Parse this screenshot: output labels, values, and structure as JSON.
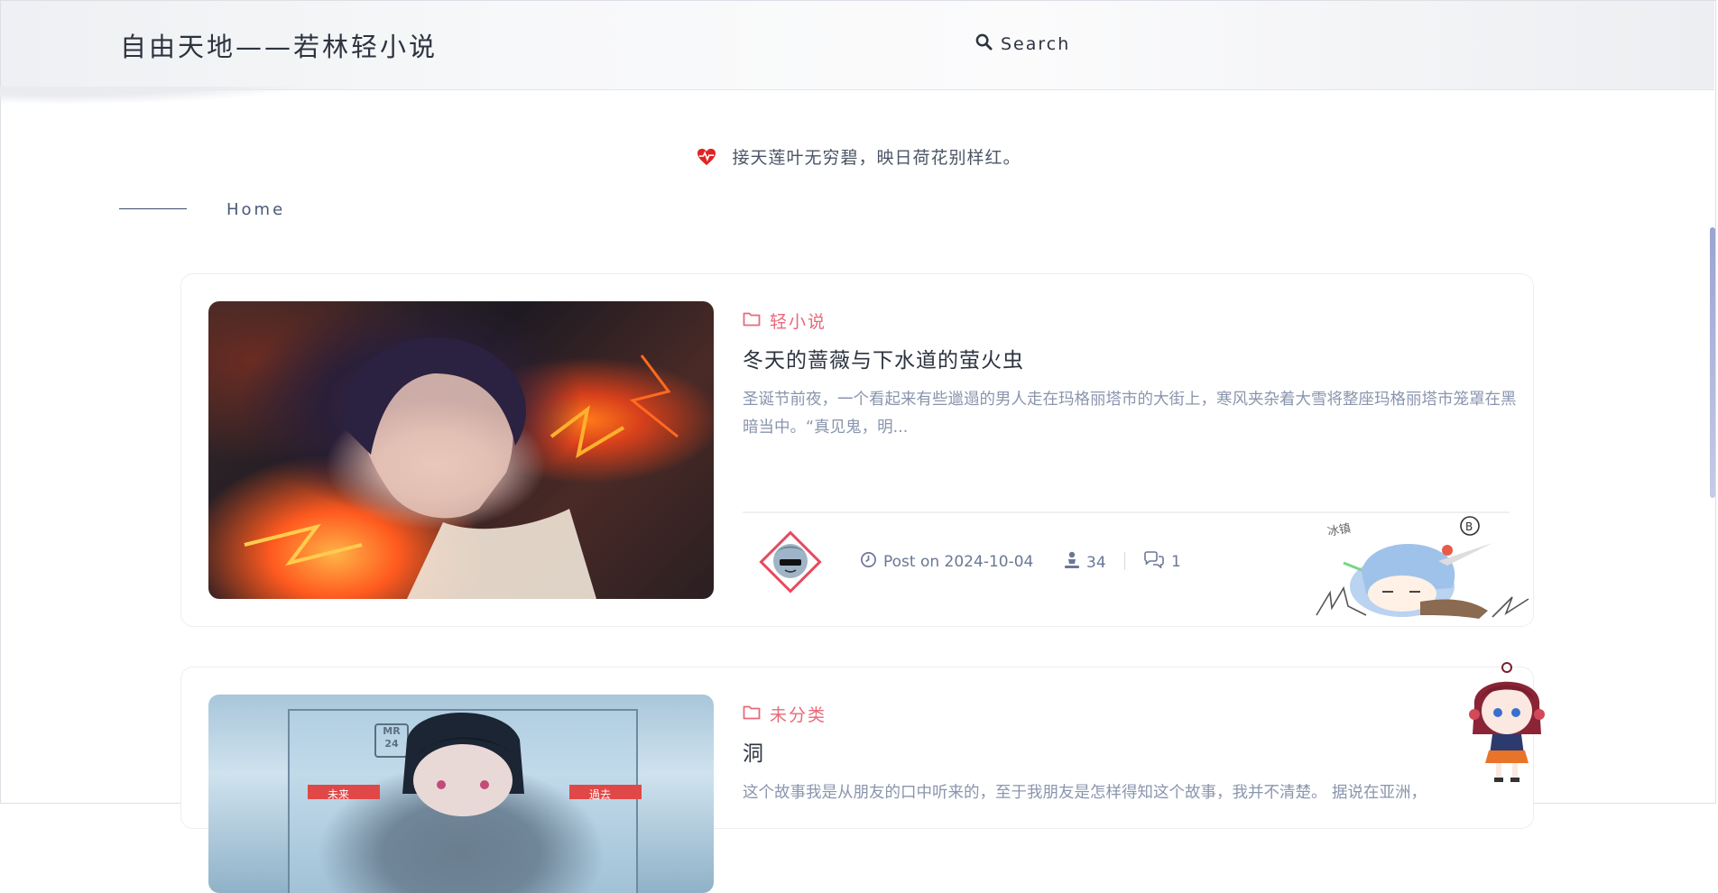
{
  "header": {
    "site_title": "自由天地——若林轻小说",
    "search_label": "Search",
    "search_icon": "search-icon"
  },
  "motto": {
    "icon": "heartbeat-icon",
    "text": "接天莲叶无穷碧，映日荷花别样红。",
    "icon_color": "#e02424"
  },
  "breadcrumb": {
    "home_label": "Home"
  },
  "posts": [
    {
      "category": "轻小说",
      "title": "冬天的蔷薇与下水道的萤火虫",
      "excerpt": "圣诞节前夜，一个看起来有些邋遢的男人走在玛格丽塔市的大街上，寒风夹杂着大雪将整座玛格丽塔市笼罩在黑暗当中。“真见鬼，明...",
      "post_date": "Post on 2024-10-04",
      "views": "34",
      "comments": "1",
      "sticker_text": "冰镇"
    },
    {
      "category": "未分类",
      "title": "洞",
      "excerpt": "这个故事我是从朋友的口中听来的，至于我朋友是怎样得知这个故事，我并不清楚。 据说在亚洲，",
      "thumb_labels": [
        "MR 24",
        "未来",
        "過去"
      ]
    }
  ],
  "colors": {
    "category": "#e8697a",
    "title": "#2d3340",
    "excerpt": "#8a95ad",
    "meta": "#6a7895"
  }
}
